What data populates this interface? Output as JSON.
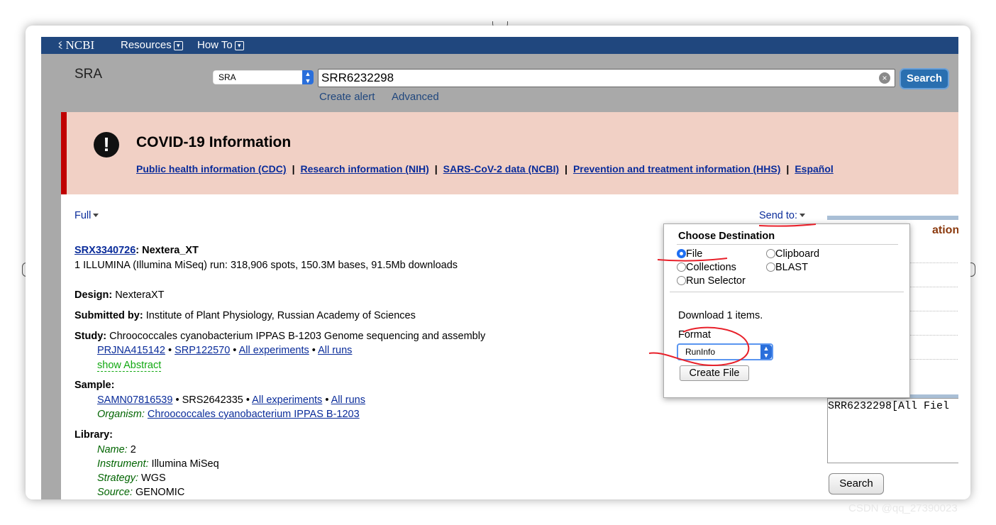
{
  "ncbi_bar": {
    "logo": "NCBI",
    "resources": "Resources",
    "how_to": "How To",
    "chevron": "▾"
  },
  "search": {
    "db_title": "SRA",
    "db_select_value": "SRA",
    "term": "SRR6232298",
    "button": "Search",
    "create_alert": "Create alert",
    "advanced": "Advanced"
  },
  "covid": {
    "title": "COVID-19 Information",
    "links": [
      "Public health information (CDC)",
      "Research information (NIH)",
      "SARS-CoV-2 data (NCBI)",
      "Prevention and treatment information (HHS)",
      "Español"
    ],
    "separator": "|"
  },
  "display": {
    "format_label": "Full",
    "send_to": "Send to:"
  },
  "record": {
    "accession": "SRX3340726",
    "title_suffix": ": Nextera_XT",
    "run_summary": "1 ILLUMINA (Illumina MiSeq) run: 318,906 spots, 150.3M bases, 91.5Mb downloads",
    "design_label": "Design:",
    "design_value": " NexteraXT",
    "submitted_label": "Submitted by:",
    "submitted_value": " Institute of Plant Physiology, Russian Academy of Sciences",
    "study_label": "Study:",
    "study_value": " Chroococcales cyanobacterium IPPAS B-1203 Genome sequencing and assembly",
    "study_links": [
      "PRJNA415142",
      "SRP122570",
      "All experiments",
      "All runs"
    ],
    "bullet": " • ",
    "show_abstract": "show Abstract",
    "sample_label": "Sample:",
    "sample_id": "SAMN07816539",
    "sample_srs": "SRS2642335",
    "sample_links": [
      "All experiments",
      "All runs"
    ],
    "organism_label": "Organism:",
    "organism_value": "Chroococcales cyanobacterium IPPAS B-1203",
    "library_label": "Library:",
    "library": {
      "name_label": "Name:",
      "name_value": " 2",
      "instrument_label": "Instrument:",
      "instrument_value": " Illumina MiSeq",
      "strategy_label": "Strategy:",
      "strategy_value": " WGS",
      "source_label": "Source:",
      "source_value": " GENOMIC"
    }
  },
  "right_panel": {
    "header_fragment": "ation",
    "query_box": "SRR6232298[All Fiel",
    "search_button": "Search"
  },
  "popup": {
    "title": "Choose Destination",
    "options": [
      "File",
      "Clipboard",
      "Collections",
      "BLAST",
      "Run Selector"
    ],
    "selected": "File",
    "download_text": "Download 1 items.",
    "format_label": "Format",
    "format_value": "RunInfo",
    "create_button": "Create File"
  },
  "watermark": "CSDN @qq_27390023",
  "colors": {
    "ncbi_blue": "#20477e",
    "covid_bg": "#f1d0c5",
    "covid_border": "#c00000",
    "link": "#0a2c9a",
    "annotation_red": "#e8202a"
  }
}
